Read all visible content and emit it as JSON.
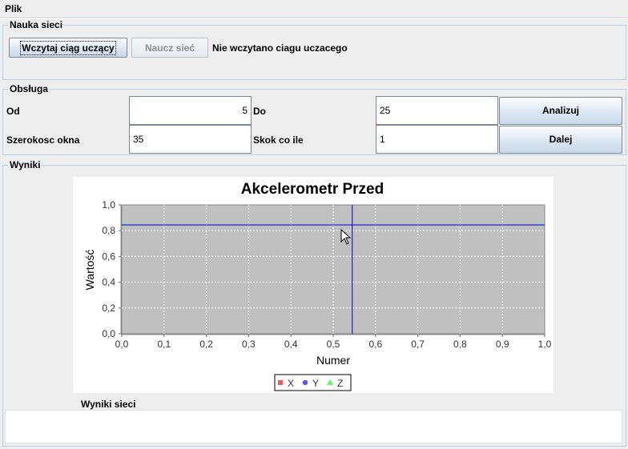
{
  "menu": {
    "file": "Plik"
  },
  "training": {
    "title": "Nauka sieci",
    "load_button": "Wczytaj ciąg uczący",
    "train_button": "Naucz sieć",
    "status": "Nie wczytano ciagu uczacego"
  },
  "controls": {
    "title": "Obsługa",
    "from_label": "Od",
    "from_value": "5",
    "to_label": "Do",
    "to_value": "25",
    "analyze_button": "Analizuj",
    "window_label": "Szerokosc okna",
    "window_value": "35",
    "step_label": "Skok co ile",
    "step_value": "1",
    "next_button": "Dalej"
  },
  "results": {
    "title": "Wyniki",
    "net_results_label": "Wyniki sieci"
  },
  "colors": {
    "plot_bg": "#c0c0c0",
    "crosshair": "#0000cc",
    "series_x": "#ff5555",
    "series_y": "#5555ff",
    "series_z": "#55ff55"
  },
  "chart_data": {
    "type": "line",
    "title": "Akcelerometr Przed",
    "xlabel": "Numer",
    "ylabel": "Wartość",
    "xlim": [
      0.0,
      1.0
    ],
    "ylim": [
      0.0,
      1.0
    ],
    "x_ticks": [
      "0,0",
      "0,1",
      "0,2",
      "0,3",
      "0,4",
      "0,5",
      "0,6",
      "0,7",
      "0,8",
      "0,9",
      "1,0"
    ],
    "y_ticks": [
      "0,0",
      "0,2",
      "0,4",
      "0,6",
      "0,8",
      "1,0"
    ],
    "grid": true,
    "legend_position": "bottom",
    "series": [
      {
        "name": "X",
        "marker": "square",
        "values": []
      },
      {
        "name": "Y",
        "marker": "circle",
        "values": []
      },
      {
        "name": "Z",
        "marker": "triangle",
        "values": []
      }
    ],
    "crosshair": {
      "x": 0.545,
      "y": 0.845
    }
  }
}
